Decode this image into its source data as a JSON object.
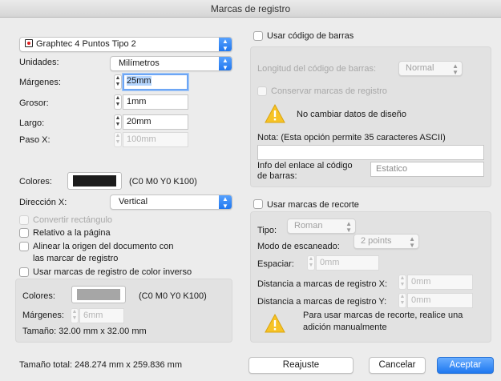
{
  "window": {
    "title": "Marcas de registro"
  },
  "left": {
    "mark_type": {
      "value": "Graphtec 4 Puntos Tipo 2"
    },
    "units": {
      "label": "Unidades:",
      "value": "Milímetros"
    },
    "margins": {
      "label": "Márgenes:",
      "value": "25mm"
    },
    "thickness": {
      "label": "Grosor:",
      "value": "1mm"
    },
    "length": {
      "label": "Largo:",
      "value": "20mm"
    },
    "step_x": {
      "label": "Paso X:",
      "value": "100mm"
    },
    "colors": {
      "label": "Colores:",
      "value": "(C0 M0 Y0 K100)",
      "swatch": "#1c1c1c"
    },
    "direction": {
      "label": "Dirección X:",
      "value": "Vertical"
    },
    "opt_rectangle": {
      "label": "Convertir rectángulo"
    },
    "opt_relative": {
      "label": "Relativo a la página"
    },
    "opt_align": {
      "label_line1": "Alinear la origen del documento con",
      "label_line2": "las marcar de registro"
    },
    "opt_inverse": {
      "label": "Usar marcas de registro de color inverso"
    },
    "inverse_group": {
      "colors_label": "Colores:",
      "colors_value": "(C0 M0 Y0 K100)",
      "swatch": "#a6a6a6",
      "margins_label": "Márgenes:",
      "margins_value": "6mm",
      "size": "Tamaño: 32.00 mm x 32.00 mm"
    },
    "total_size": "Tamaño total: 248.274 mm x 259.836 mm"
  },
  "right": {
    "barcode": {
      "checkbox_label": "Usar código de barras",
      "length_label": "Longitud del código de barras:",
      "length_value": "Normal",
      "keep_marks_label": "Conservar marcas de registro",
      "warning": "No cambiar datos de diseño",
      "note_label": "Nota: (Esta opción permite 35 caracteres ASCII)",
      "note_value": "",
      "link_label_line1": "Info del enlace al código",
      "link_label_line2": "de barras:",
      "link_value": "Estatico"
    },
    "crop": {
      "checkbox_label": "Usar marcas de recorte",
      "type_label": "Tipo:",
      "type_value": "Roman",
      "scan_label": "Modo de escaneado:",
      "scan_value": "2 points",
      "spacing_label": "Espaciar:",
      "spacing_value": "0mm",
      "dist_x_label": "Distancia a marcas de registro X:",
      "dist_x_value": "0mm",
      "dist_y_label": "Distancia a marcas de registro Y:",
      "dist_y_value": "0mm",
      "warning_line1": "Para usar marcas de recorte, realice una",
      "warning_line2": "adición manualmente"
    }
  },
  "buttons": {
    "reset": "Reajuste",
    "cancel": "Cancelar",
    "accept": "Aceptar"
  },
  "colors": {
    "accent": "#1f78f0",
    "group_bg": "#e2e2e2",
    "warning": "#f7c325"
  },
  "icons": {
    "mark_type": "registration-mark-icon",
    "warning": "warning-triangle-icon"
  }
}
